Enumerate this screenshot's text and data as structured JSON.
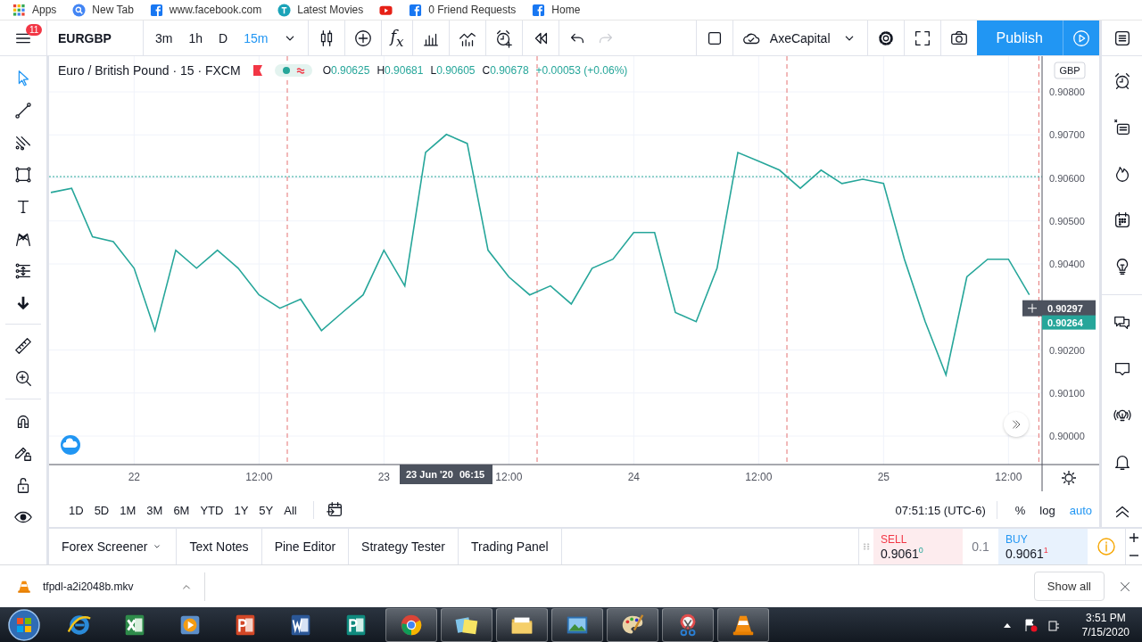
{
  "bookmarks": [
    {
      "kind": "apps",
      "label": "Apps"
    },
    {
      "kind": "search",
      "label": "New Tab"
    },
    {
      "kind": "facebook",
      "label": "www.facebook.com"
    },
    {
      "kind": "circle",
      "label": "Latest Movies"
    },
    {
      "kind": "video"
    },
    {
      "kind": "facebook",
      "label": "0 Friend Requests"
    },
    {
      "kind": "facebook",
      "label": "Home"
    }
  ],
  "toolbar": {
    "notifications": "11",
    "symbol": "EURGBP",
    "intervals": [
      {
        "label": "3m",
        "selected": false
      },
      {
        "label": "1h",
        "selected": false
      },
      {
        "label": "D",
        "selected": false
      },
      {
        "label": "15m",
        "selected": true
      }
    ],
    "indicators": "f$_{x}$",
    "undo": {
      "disabled": false
    },
    "redo": {
      "disabled": true
    },
    "account": "AxeCapital",
    "publish": "Publish"
  },
  "left_tool_groups": [
    [
      {
        "kind": "cursor",
        "selected": true
      },
      {
        "kind": "trend",
        "selected": false
      },
      {
        "kind": "channel",
        "selected": false
      },
      {
        "kind": "rectangle",
        "selected": false
      },
      {
        "kind": "text",
        "selected": false
      },
      {
        "kind": "pattern",
        "selected": false
      },
      {
        "kind": "fib",
        "selected": false
      },
      {
        "kind": "arrow",
        "selected": false
      }
    ],
    [
      {
        "kind": "ruler",
        "selected": false
      },
      {
        "kind": "zoom",
        "selected": false
      }
    ],
    [
      {
        "kind": "magnet",
        "selected": false
      },
      {
        "kind": "pencil-lock",
        "selected": false
      },
      {
        "kind": "lock",
        "selected": false
      },
      {
        "kind": "eye",
        "selected": false
      }
    ]
  ],
  "legend": {
    "title": "Euro / British Pound · 15 · FXCM",
    "ohlc": [
      {
        "label": "O",
        "value": "0.90625"
      },
      {
        "label": "H",
        "value": "0.90681"
      },
      {
        "label": "L",
        "value": "0.90605"
      },
      {
        "label": "C",
        "value": "0.90678"
      }
    ],
    "change": "+0.00053 (+0.06%)"
  },
  "chart": {
    "currency": "GBP",
    "crosshair_time": {
      "date": "23 Jun '20",
      "time": "06:15"
    },
    "chart_data": {
      "type": "line",
      "ylim": [
        0.899337,
        0.908829
      ],
      "categories": [
        null,
        null,
        null,
        null,
        "22",
        null,
        null,
        null,
        null,
        null,
        "12:00",
        null,
        null,
        null,
        null,
        null,
        "23",
        null,
        null,
        null,
        null,
        null,
        "12:00",
        null,
        null,
        null,
        null,
        null,
        "24",
        null,
        null,
        null,
        null,
        null,
        "12:00",
        null,
        null,
        null,
        null,
        null,
        "25",
        null,
        null,
        null,
        null,
        null,
        "12:00",
        null
      ],
      "series": [
        {
          "color": "#26a69a",
          "values": [
            0.90566,
            0.90576,
            0.90463,
            0.90452,
            0.9039,
            0.90245,
            0.90432,
            0.9039,
            0.90432,
            0.9039,
            0.90328,
            0.90297,
            0.90318,
            0.90245,
            0.90287,
            0.90328,
            0.90432,
            0.90349,
            0.90659,
            0.90701,
            0.9068,
            0.90432,
            0.9037,
            0.90328,
            0.90349,
            0.90307,
            0.9039,
            0.90411,
            0.90473,
            0.90473,
            0.90287,
            0.90266,
            0.9039,
            0.90659,
            0.90639,
            0.90618,
            0.90576,
            0.90618,
            0.90587,
            0.90597,
            0.90587,
            0.90411,
            0.90266,
            0.90142,
            0.9037,
            0.90411,
            0.90411,
            0.90328
          ]
        }
      ],
      "yticks": [
        {
          "value": 0.9,
          "label": "0.90000"
        },
        {
          "value": 0.901,
          "label": "0.90100"
        },
        {
          "value": 0.902,
          "label": "0.90200"
        },
        {
          "value": 0.904,
          "label": "0.90400"
        },
        {
          "value": 0.905,
          "label": "0.90500"
        },
        {
          "value": 0.906,
          "label": "0.90600"
        },
        {
          "value": 0.907,
          "label": "0.90700"
        },
        {
          "value": 0.908,
          "label": "0.90800"
        }
      ],
      "grid": true,
      "ref_lines": [
        {
          "axis": "y",
          "value": 0.90603,
          "color": "#26a69a"
        }
      ],
      "annotations": [
        "0.90297",
        "0.90264"
      ]
    }
  },
  "ranges": [
    "1D",
    "5D",
    "1M",
    "3M",
    "6M",
    "YTD",
    "1Y",
    "5Y",
    "All"
  ],
  "clock": "07:51:15 (UTC-6)",
  "scale_toggles": [
    {
      "label": "%",
      "on": false
    },
    {
      "label": "log",
      "on": false
    },
    {
      "label": "auto",
      "on": true
    }
  ],
  "right_tool_groups": [
    [
      {
        "kind": "alarm"
      },
      {
        "kind": "notes"
      },
      {
        "kind": "flame"
      },
      {
        "kind": "calendar"
      },
      {
        "kind": "bulb"
      }
    ],
    [
      {
        "kind": "chats"
      },
      {
        "kind": "chat"
      },
      {
        "kind": "broadcast"
      },
      {
        "kind": "bell"
      }
    ]
  ],
  "bottom_tabs": [
    {
      "label": "Forex Screener",
      "has_menu": true
    },
    {
      "label": "Text Notes",
      "has_menu": false
    },
    {
      "label": "Pine Editor",
      "has_menu": false
    },
    {
      "label": "Strategy Tester",
      "has_menu": false
    },
    {
      "label": "Trading Panel",
      "has_menu": false
    }
  ],
  "trade": {
    "sell": {
      "label": "SELL",
      "price": "0.9061",
      "tick": "0"
    },
    "quantity": "0.1",
    "buy": {
      "label": "BUY",
      "price": "0.9061",
      "tick": "1"
    }
  },
  "download": {
    "file": "tfpdl-a2i2048b.mkv",
    "show_all": "Show all"
  },
  "taskbar": {
    "apps": [
      {
        "kind": "ie",
        "running": false
      },
      {
        "kind": "excel",
        "running": false
      },
      {
        "kind": "media",
        "running": false
      },
      {
        "kind": "powerpoint",
        "running": false
      },
      {
        "kind": "word",
        "running": false
      },
      {
        "kind": "publisher",
        "running": false
      },
      {
        "kind": "chrome",
        "running": true
      },
      {
        "kind": "sticky",
        "running": true
      },
      {
        "kind": "folder",
        "running": true
      },
      {
        "kind": "picture",
        "running": true
      },
      {
        "kind": "paint",
        "running": true
      },
      {
        "kind": "snip",
        "running": true
      },
      {
        "kind": "vlc",
        "running": true
      }
    ],
    "time": "3:51 PM",
    "date": "7/15/2020"
  }
}
